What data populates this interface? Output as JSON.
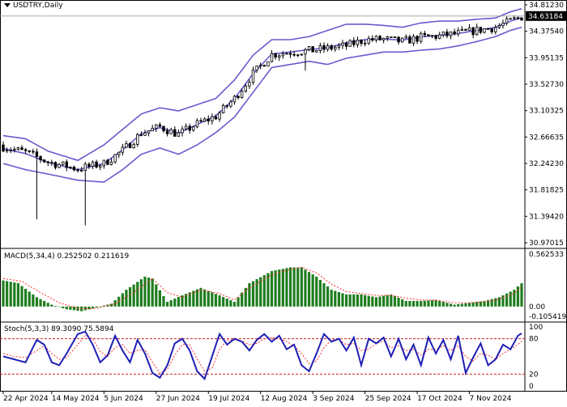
{
  "main": {
    "menu_icon": "triangle-down-icon",
    "symbol": "USDTRY,Daily",
    "current_price": "34.63184",
    "price_axis_labels": [
      "34.81230",
      "34.37540",
      "33.95135",
      "33.52730",
      "33.10325",
      "32.66635",
      "32.24230",
      "31.81825",
      "31.39420",
      "30.97015"
    ]
  },
  "macd": {
    "label": "MACD(5,34,4) 0.252502 0.211619",
    "axis_labels": [
      "0.562533",
      "0.00",
      "-0.105419"
    ]
  },
  "stoch": {
    "label": "Stoch(5,3,3) 89.3090 75.5894",
    "axis_labels": [
      "100",
      "80",
      "20",
      "0"
    ]
  },
  "time_axis_labels": [
    "22 Apr 2024",
    "14 May 2024",
    "5 Jun 2024",
    "27 Jun 2024",
    "19 Jul 2024",
    "12 Aug 2024",
    "3 Sep 2024",
    "25 Sep 2024",
    "17 Oct 2024",
    "7 Nov 2024"
  ],
  "colors": {
    "bollinger": "#6a5acd",
    "macd_hist": "#1e7d1e",
    "macd_signal": "#ff3030",
    "stoch_main": "#1f1fb4",
    "stoch_signal": "#ff3030",
    "levels": "#cc2222"
  },
  "chart_data": [
    {
      "type": "candlestick",
      "title": "USDTRY,Daily",
      "ylim": [
        30.97015,
        34.8123
      ],
      "x_ticks": [
        "22 Apr 2024",
        "14 May 2024",
        "5 Jun 2024",
        "27 Jun 2024",
        "19 Jul 2024",
        "12 Aug 2024",
        "3 Sep 2024",
        "25 Sep 2024",
        "17 Oct 2024",
        "7 Nov 2024"
      ],
      "x_tick_positions": [
        0,
        13,
        27,
        41,
        55,
        69,
        83,
        97,
        111,
        125
      ],
      "n_bars": 140,
      "series": [
        {
          "name": "",
          "values_knots": [
            [
              0,
              32.55
            ],
            [
              6,
              32.45
            ],
            [
              12,
              32.28
            ],
            [
              20,
              32.18
            ],
            [
              27,
              32.25
            ],
            [
              32,
              32.45
            ],
            [
              37,
              32.75
            ],
            [
              42,
              32.85
            ],
            [
              47,
              32.7
            ],
            [
              52,
              32.9
            ],
            [
              57,
              33.0
            ],
            [
              62,
              33.3
            ],
            [
              67,
              33.7
            ],
            [
              72,
              34.0
            ],
            [
              77,
              34.05
            ],
            [
              82,
              34.05
            ],
            [
              87,
              34.1
            ],
            [
              92,
              34.1
            ],
            [
              97,
              34.25
            ],
            [
              102,
              34.25
            ],
            [
              107,
              34.2
            ],
            [
              112,
              34.28
            ],
            [
              117,
              34.3
            ],
            [
              122,
              34.35
            ],
            [
              127,
              34.4
            ],
            [
              132,
              34.45
            ],
            [
              136,
              34.55
            ],
            [
              139,
              34.63
            ]
          ]
        },
        {
          "name": "",
          "values_knots": [
            [
              0,
              32.7
            ],
            [
              6,
              32.65
            ],
            [
              12,
              32.45
            ],
            [
              20,
              32.3
            ],
            [
              27,
              32.55
            ],
            [
              32,
              32.8
            ],
            [
              37,
              33.05
            ],
            [
              42,
              33.15
            ],
            [
              47,
              33.1
            ],
            [
              52,
              33.2
            ],
            [
              57,
              33.3
            ],
            [
              62,
              33.6
            ],
            [
              67,
              34.0
            ],
            [
              72,
              34.25
            ],
            [
              77,
              34.25
            ],
            [
              82,
              34.3
            ],
            [
              87,
              34.4
            ],
            [
              92,
              34.5
            ],
            [
              97,
              34.5
            ],
            [
              102,
              34.48
            ],
            [
              107,
              34.45
            ],
            [
              112,
              34.52
            ],
            [
              117,
              34.55
            ],
            [
              122,
              34.55
            ],
            [
              127,
              34.58
            ],
            [
              132,
              34.6
            ],
            [
              136,
              34.7
            ],
            [
              139,
              34.75
            ]
          ]
        },
        {
          "name": "",
          "values_knots": [
            [
              0,
              32.25
            ],
            [
              6,
              32.15
            ],
            [
              12,
              32.08
            ],
            [
              20,
              31.98
            ],
            [
              27,
              31.95
            ],
            [
              32,
              32.15
            ],
            [
              37,
              32.4
            ],
            [
              42,
              32.5
            ],
            [
              47,
              32.4
            ],
            [
              52,
              32.55
            ],
            [
              57,
              32.75
            ],
            [
              62,
              33.0
            ],
            [
              67,
              33.4
            ],
            [
              72,
              33.8
            ],
            [
              77,
              33.85
            ],
            [
              82,
              33.9
            ],
            [
              87,
              33.85
            ],
            [
              92,
              33.95
            ],
            [
              97,
              34.0
            ],
            [
              102,
              34.05
            ],
            [
              107,
              34.05
            ],
            [
              112,
              34.08
            ],
            [
              117,
              34.1
            ],
            [
              122,
              34.15
            ],
            [
              127,
              34.22
            ],
            [
              132,
              34.3
            ],
            [
              136,
              34.4
            ],
            [
              139,
              34.45
            ]
          ]
        }
      ],
      "spikes": [
        [
          9,
          31.35
        ],
        [
          22,
          31.25
        ],
        [
          81,
          33.75
        ]
      ]
    },
    {
      "type": "bar",
      "title": "MACD(5,34,4) 0.252502 0.211619",
      "ylim": [
        -0.105419,
        0.562533
      ],
      "hist_knots": [
        [
          0,
          0.28
        ],
        [
          4,
          0.25
        ],
        [
          9,
          0.1
        ],
        [
          13,
          0.02
        ],
        [
          17,
          -0.03
        ],
        [
          21,
          -0.05
        ],
        [
          25,
          -0.01
        ],
        [
          29,
          0.03
        ],
        [
          33,
          0.18
        ],
        [
          38,
          0.32
        ],
        [
          40,
          0.3
        ],
        [
          44,
          0.05
        ],
        [
          48,
          0.12
        ],
        [
          53,
          0.2
        ],
        [
          58,
          0.12
        ],
        [
          62,
          0.05
        ],
        [
          66,
          0.25
        ],
        [
          72,
          0.38
        ],
        [
          77,
          0.42
        ],
        [
          80,
          0.42
        ],
        [
          84,
          0.32
        ],
        [
          88,
          0.18
        ],
        [
          92,
          0.13
        ],
        [
          96,
          0.13
        ],
        [
          100,
          0.1
        ],
        [
          104,
          0.13
        ],
        [
          108,
          0.06
        ],
        [
          112,
          0.06
        ],
        [
          116,
          0.07
        ],
        [
          121,
          0.02
        ],
        [
          125,
          0.04
        ],
        [
          129,
          0.06
        ],
        [
          133,
          0.1
        ],
        [
          137,
          0.18
        ],
        [
          139,
          0.25
        ]
      ],
      "signal_knots": [
        [
          0,
          0.3
        ],
        [
          5,
          0.27
        ],
        [
          10,
          0.15
        ],
        [
          15,
          0.04
        ],
        [
          20,
          -0.02
        ],
        [
          25,
          -0.02
        ],
        [
          30,
          0.03
        ],
        [
          35,
          0.15
        ],
        [
          40,
          0.3
        ],
        [
          44,
          0.15
        ],
        [
          48,
          0.1
        ],
        [
          53,
          0.18
        ],
        [
          58,
          0.14
        ],
        [
          62,
          0.07
        ],
        [
          66,
          0.2
        ],
        [
          72,
          0.34
        ],
        [
          77,
          0.4
        ],
        [
          80,
          0.42
        ],
        [
          84,
          0.36
        ],
        [
          88,
          0.24
        ],
        [
          92,
          0.16
        ],
        [
          96,
          0.14
        ],
        [
          100,
          0.12
        ],
        [
          104,
          0.12
        ],
        [
          108,
          0.09
        ],
        [
          112,
          0.07
        ],
        [
          116,
          0.07
        ],
        [
          121,
          0.04
        ],
        [
          125,
          0.04
        ],
        [
          129,
          0.05
        ],
        [
          133,
          0.08
        ],
        [
          137,
          0.14
        ],
        [
          139,
          0.21
        ]
      ]
    },
    {
      "type": "line",
      "title": "Stoch(5,3,3) 89.3090 75.5894",
      "ylim": [
        0,
        100
      ],
      "levels": [
        80,
        20
      ],
      "main_knots": [
        [
          0,
          50
        ],
        [
          3,
          45
        ],
        [
          6,
          40
        ],
        [
          9,
          78
        ],
        [
          11,
          70
        ],
        [
          13,
          40
        ],
        [
          15,
          35
        ],
        [
          17,
          55
        ],
        [
          20,
          88
        ],
        [
          22,
          92
        ],
        [
          24,
          70
        ],
        [
          26,
          40
        ],
        [
          28,
          52
        ],
        [
          30,
          85
        ],
        [
          32,
          60
        ],
        [
          34,
          40
        ],
        [
          36,
          78
        ],
        [
          38,
          55
        ],
        [
          40,
          22
        ],
        [
          42,
          14
        ],
        [
          44,
          35
        ],
        [
          46,
          72
        ],
        [
          48,
          80
        ],
        [
          50,
          60
        ],
        [
          52,
          25
        ],
        [
          54,
          12
        ],
        [
          56,
          50
        ],
        [
          58,
          88
        ],
        [
          60,
          70
        ],
        [
          62,
          80
        ],
        [
          64,
          75
        ],
        [
          66,
          60
        ],
        [
          68,
          78
        ],
        [
          70,
          88
        ],
        [
          72,
          75
        ],
        [
          74,
          85
        ],
        [
          76,
          62
        ],
        [
          78,
          70
        ],
        [
          80,
          35
        ],
        [
          82,
          25
        ],
        [
          84,
          55
        ],
        [
          86,
          88
        ],
        [
          88,
          75
        ],
        [
          90,
          80
        ],
        [
          92,
          60
        ],
        [
          94,
          82
        ],
        [
          96,
          35
        ],
        [
          98,
          80
        ],
        [
          100,
          72
        ],
        [
          102,
          82
        ],
        [
          104,
          50
        ],
        [
          106,
          80
        ],
        [
          108,
          45
        ],
        [
          110,
          70
        ],
        [
          112,
          35
        ],
        [
          114,
          82
        ],
        [
          116,
          55
        ],
        [
          118,
          78
        ],
        [
          120,
          45
        ],
        [
          122,
          85
        ],
        [
          124,
          22
        ],
        [
          126,
          48
        ],
        [
          128,
          72
        ],
        [
          130,
          35
        ],
        [
          132,
          45
        ],
        [
          134,
          70
        ],
        [
          136,
          62
        ],
        [
          138,
          85
        ],
        [
          139,
          89
        ]
      ],
      "signal_knots": [
        [
          0,
          55
        ],
        [
          3,
          50
        ],
        [
          6,
          48
        ],
        [
          9,
          60
        ],
        [
          11,
          68
        ],
        [
          13,
          55
        ],
        [
          15,
          45
        ],
        [
          17,
          48
        ],
        [
          20,
          70
        ],
        [
          22,
          85
        ],
        [
          24,
          80
        ],
        [
          26,
          58
        ],
        [
          28,
          50
        ],
        [
          30,
          65
        ],
        [
          32,
          70
        ],
        [
          34,
          55
        ],
        [
          36,
          60
        ],
        [
          38,
          62
        ],
        [
          40,
          40
        ],
        [
          42,
          22
        ],
        [
          44,
          28
        ],
        [
          46,
          52
        ],
        [
          48,
          70
        ],
        [
          50,
          70
        ],
        [
          52,
          45
        ],
        [
          54,
          25
        ],
        [
          56,
          30
        ],
        [
          58,
          62
        ],
        [
          60,
          78
        ],
        [
          62,
          78
        ],
        [
          64,
          76
        ],
        [
          66,
          70
        ],
        [
          68,
          72
        ],
        [
          70,
          80
        ],
        [
          72,
          82
        ],
        [
          74,
          80
        ],
        [
          76,
          75
        ],
        [
          78,
          68
        ],
        [
          80,
          55
        ],
        [
          82,
          38
        ],
        [
          84,
          42
        ],
        [
          86,
          65
        ],
        [
          88,
          78
        ],
        [
          90,
          78
        ],
        [
          92,
          70
        ],
        [
          94,
          72
        ],
        [
          96,
          60
        ],
        [
          98,
          62
        ],
        [
          100,
          72
        ],
        [
          102,
          76
        ],
        [
          104,
          65
        ],
        [
          106,
          68
        ],
        [
          108,
          60
        ],
        [
          110,
          62
        ],
        [
          112,
          52
        ],
        [
          114,
          62
        ],
        [
          116,
          62
        ],
        [
          118,
          68
        ],
        [
          120,
          60
        ],
        [
          122,
          68
        ],
        [
          124,
          50
        ],
        [
          126,
          42
        ],
        [
          128,
          55
        ],
        [
          130,
          52
        ],
        [
          132,
          45
        ],
        [
          134,
          55
        ],
        [
          136,
          62
        ],
        [
          138,
          70
        ],
        [
          139,
          75.6
        ]
      ]
    }
  ]
}
